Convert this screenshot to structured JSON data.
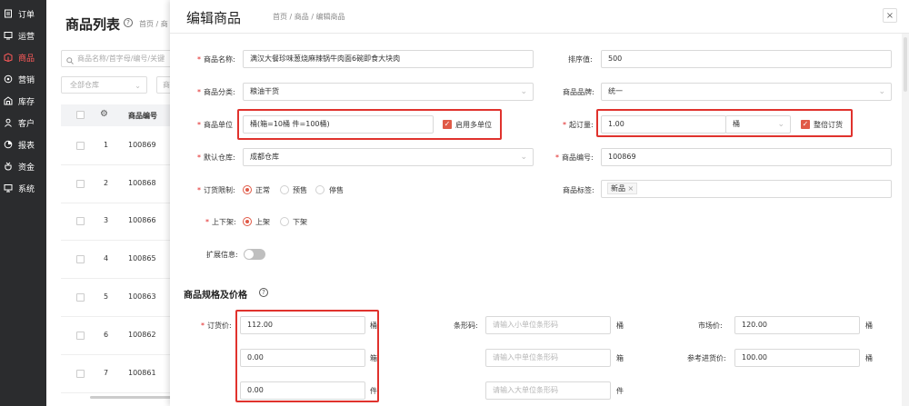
{
  "sidebar": {
    "items": [
      {
        "label": "订单",
        "icon": "order-icon",
        "active": false
      },
      {
        "label": "运营",
        "icon": "operation-icon",
        "active": false
      },
      {
        "label": "商品",
        "icon": "goods-icon",
        "active": true
      },
      {
        "label": "营销",
        "icon": "marketing-icon",
        "active": false
      },
      {
        "label": "库存",
        "icon": "warehouse-icon",
        "active": false
      },
      {
        "label": "客户",
        "icon": "customer-icon",
        "active": false
      },
      {
        "label": "报表",
        "icon": "report-icon",
        "active": false
      },
      {
        "label": "资金",
        "icon": "money-icon",
        "active": false
      },
      {
        "label": "系统",
        "icon": "system-icon",
        "active": false
      }
    ]
  },
  "list_page": {
    "title": "商品列表",
    "help": "?",
    "breadcrumb": "首页 / 商",
    "search_placeholder": "商品名称/首字母/编号/关键",
    "warehouse_select": "全部仓库",
    "second_select": "商",
    "column_header": "商品编号",
    "rows": [
      {
        "index": "1",
        "code": "100869"
      },
      {
        "index": "2",
        "code": "100868"
      },
      {
        "index": "3",
        "code": "100866"
      },
      {
        "index": "4",
        "code": "100865"
      },
      {
        "index": "5",
        "code": "100863"
      },
      {
        "index": "6",
        "code": "100862"
      },
      {
        "index": "7",
        "code": "100861"
      }
    ]
  },
  "modal": {
    "title": "编辑商品",
    "breadcrumb": "首页 / 商品 / 编辑商品",
    "close": "×",
    "form": {
      "name_label": "商品名称:",
      "name_value": "满汉大餐珍味葱烧麻辣锅牛肉面6碗即食大块肉",
      "sort_label": "排序值:",
      "sort_value": "500",
      "category_label": "商品分类:",
      "category_value": "粮油干货",
      "brand_label": "商品品牌:",
      "brand_value": "统一",
      "unit_label": "商品单位",
      "unit_value": "桶(箱=10桶 件=100桶)",
      "multi_unit_label": "启用多单位",
      "min_order_label": "起订量:",
      "min_order_value": "1.00",
      "min_order_unit": "桶",
      "whole_order_label": "整倍订货",
      "warehouse_label": "默认仓库:",
      "warehouse_value": "成都仓库",
      "code_label": "商品编号:",
      "code_value": "100869",
      "order_limit_label": "订货限制:",
      "order_limit_options": [
        "正常",
        "预售",
        "停售"
      ],
      "tags_label": "商品标签:",
      "tag_value": "新品",
      "shelf_label": "上下架:",
      "shelf_options": [
        "上架",
        "下架"
      ],
      "ext_label": "扩展信息:"
    },
    "spec": {
      "section_title": "商品规格及价格",
      "help": "?",
      "order_price_label": "订货价:",
      "prices": [
        {
          "value": "112.00",
          "unit": "桶"
        },
        {
          "value": "0.00",
          "unit": "箱"
        },
        {
          "value": "0.00",
          "unit": "件"
        }
      ],
      "barcode_label": "条形码:",
      "barcodes": [
        {
          "placeholder": "请输入小单位条形码",
          "unit": "桶"
        },
        {
          "placeholder": "请输入中单位条形码",
          "unit": "箱"
        },
        {
          "placeholder": "请输入大单位条形码",
          "unit": "件"
        }
      ],
      "market_price_label": "市场价:",
      "market_price_value": "120.00",
      "market_price_unit": "桶",
      "ref_cost_label": "参考进货价:",
      "ref_cost_value": "100.00",
      "ref_cost_unit": "桶"
    }
  },
  "colors": {
    "sidebar_bg": "#2b2c2e",
    "accent": "#e05a47",
    "highlight_box": "#e0322d",
    "active_menu": "#ff5a5a"
  }
}
